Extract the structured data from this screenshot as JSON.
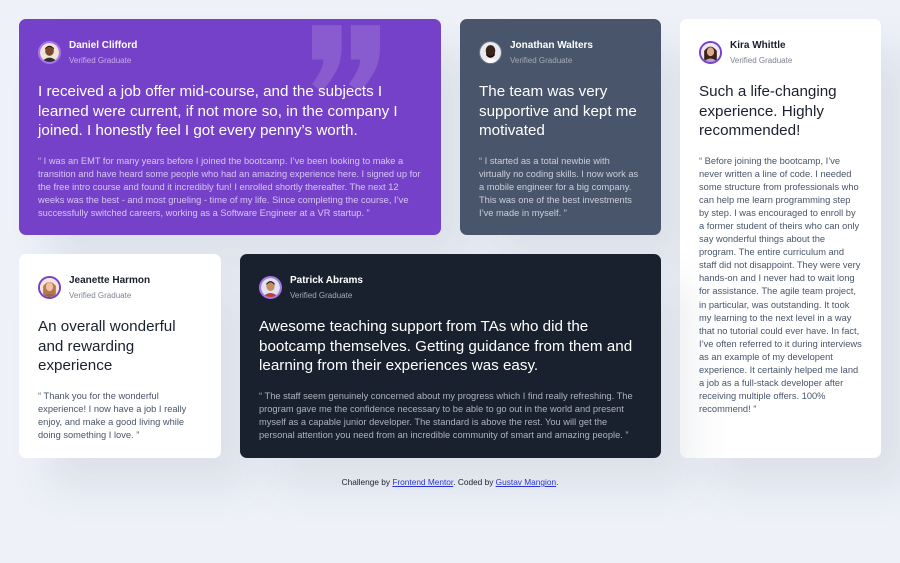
{
  "testimonials": [
    {
      "name": "Daniel Clifford",
      "role": "Verified Graduate",
      "headline": "I received a job offer mid-course, and the subjects I learned were current, if not more so, in the company I joined. I honestly feel I got every penny’s worth.",
      "quote": "“ I was an EMT for many years before I joined the bootcamp. I’ve been looking to make a transition and have heard some people who had an amazing experience here. I signed up for the free intro course and found it incredibly fun! I enrolled shortly thereafter. The next 12 weeks was the best - and most grueling - time of my life. Since completing the course, I’ve successfully switched careers, working as a Software Engineer at a VR startup. ”"
    },
    {
      "name": "Jonathan Walters",
      "role": "Verified Graduate",
      "headline": "The team was very supportive and kept me motivated",
      "quote": "“ I started as a total newbie with virtually no coding skills. I now work as a mobile engineer for a big company. This was one of the best investments I’ve made in myself. ”"
    },
    {
      "name": "Kira Whittle",
      "role": "Verified Graduate",
      "headline": "Such a life-changing experience. Highly recommended!",
      "quote": "“ Before joining the bootcamp, I’ve never written a line of code. I needed some structure from professionals who can help me learn programming step by step. I was encouraged to enroll by a former student of theirs who can only say wonderful things about the program. The entire curriculum and staff did not disappoint. They were very hands-on and I never had to wait long for assistance. The agile team project, in particular, was outstanding. It took my learning to the next level in a way that no tutorial could ever have. In fact, I’ve often referred to it during interviews as an example of my developent experience. It certainly helped me land a job as a full-stack developer after receiving multiple offers. 100% recommend! ”"
    },
    {
      "name": "Jeanette Harmon",
      "role": "Verified Graduate",
      "headline": "An overall wonderful and rewarding experience",
      "quote": "“ Thank you for the wonderful experience! I now have a job I really enjoy, and make a good living while doing something I love. ”"
    },
    {
      "name": "Patrick Abrams",
      "role": "Verified Graduate",
      "headline": "Awesome teaching support from TAs who did the bootcamp themselves. Getting guidance from them and learning from their experiences was easy.",
      "quote": "“ The staff seem genuinely concerned about my progress which I find really refreshing. The program gave me the confidence necessary to be able to go out in the world and present myself as a capable junior developer. The standard is above the rest. You will get the personal attention you need from an incredible community of smart and amazing people. ”"
    }
  ],
  "attribution": {
    "prefix": "Challenge by ",
    "link1": "Frontend Mentor",
    "middle": ". Coded by ",
    "link2": "Gustav Mangion",
    "suffix": "."
  },
  "colors": {
    "moderate_violet": "#7541c8",
    "grayish_blue": "#48556a",
    "very_dark_blue": "#19212e",
    "white": "#ffffff",
    "page_background": "#eef1f8"
  },
  "icons": {
    "quote_mark": "quotation-icon"
  }
}
